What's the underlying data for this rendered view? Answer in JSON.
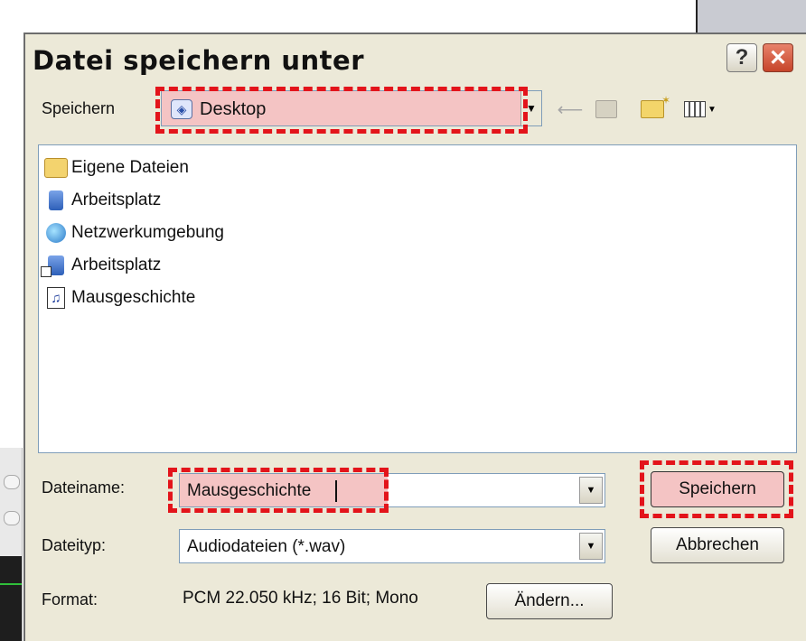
{
  "dialog": {
    "title": "Datei speichern unter",
    "help_label": "?",
    "close_label": "✕"
  },
  "location": {
    "label": "Speichern",
    "value": "Desktop"
  },
  "files": [
    {
      "name": "Eigene Dateien",
      "icon": "my-documents-icon"
    },
    {
      "name": "Arbeitsplatz",
      "icon": "my-computer-icon"
    },
    {
      "name": "Netzwerkumgebung",
      "icon": "network-places-icon"
    },
    {
      "name": "Arbeitsplatz",
      "icon": "computer-shortcut-icon"
    },
    {
      "name": "Mausgeschichte",
      "icon": "audio-file-icon"
    }
  ],
  "filename": {
    "label": "Dateiname:",
    "value": "Mausgeschichte"
  },
  "filetype": {
    "label": "Dateityp:",
    "value": "Audiodateien (*.wav)"
  },
  "format": {
    "label": "Format:",
    "value": "PCM 22.050 kHz; 16 Bit; Mono"
  },
  "buttons": {
    "save": "Speichern",
    "cancel": "Abbrechen",
    "change": "Ändern..."
  },
  "colors": {
    "dialog_bg": "#ece9d8",
    "highlight_dash": "#e3141b",
    "highlight_fill": "#f4c4c4"
  }
}
